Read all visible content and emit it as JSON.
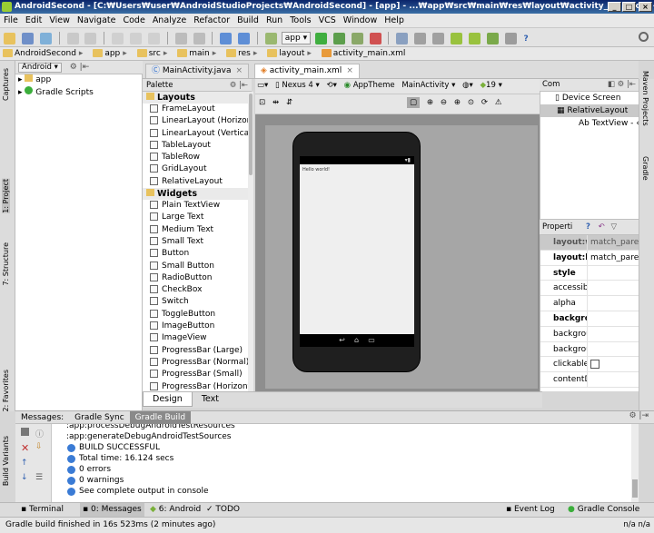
{
  "window": {
    "title": "AndroidSecond - [C:₩Users₩user₩AndroidStudioProjects₩AndroidSecond] - [app] - ...₩app₩src₩main₩res₩layout₩activity_main.xml - "
  },
  "menu": [
    "File",
    "Edit",
    "View",
    "Navigate",
    "Code",
    "Analyze",
    "Refactor",
    "Build",
    "Run",
    "Tools",
    "VCS",
    "Window",
    "Help"
  ],
  "toolbar": {
    "run_config": "app",
    "help": "?"
  },
  "breadcrumbs": [
    "AndroidSecond",
    "app",
    "src",
    "main",
    "res",
    "layout",
    "activity_main.xml"
  ],
  "project": {
    "view_selector": "Android",
    "tree": [
      "app",
      "Gradle Scripts"
    ]
  },
  "left_tabs": [
    "1: Project",
    "7: Structure",
    "Captures",
    "2: Favorites",
    "Build Variants"
  ],
  "right_tabs": [
    "Maven Projects",
    "Gradle"
  ],
  "editor": {
    "tabs": [
      "MainActivity.java",
      "activity_main.xml"
    ]
  },
  "palette": {
    "header": "Palette",
    "layouts_title": "Layouts",
    "layouts": [
      "FrameLayout",
      "LinearLayout (Horizonta",
      "LinearLayout (Vertical)",
      "TableLayout",
      "TableRow",
      "GridLayout",
      "RelativeLayout"
    ],
    "widgets_title": "Widgets",
    "widgets": [
      "Plain TextView",
      "Large Text",
      "Medium Text",
      "Small Text",
      "Button",
      "Small Button",
      "RadioButton",
      "CheckBox",
      "Switch",
      "ToggleButton",
      "ImageButton",
      "ImageView",
      "ProgressBar (Large)",
      "ProgressBar (Normal)",
      "ProgressBar (Small)",
      "ProgressBar (Horizonta"
    ]
  },
  "design_toolbar": {
    "device": "Nexus 4",
    "theme": "AppTheme",
    "activity": "MainActivity",
    "api": "19"
  },
  "preview": {
    "text": "Hello world!"
  },
  "design_tabs": [
    "Design",
    "Text"
  ],
  "component_tree": {
    "header": "Com",
    "items": [
      "Device Screen",
      "RelativeLayout",
      "TextView - «"
    ]
  },
  "properties": {
    "header": "Properti",
    "rows": [
      {
        "key": "layout:w",
        "value": "match_paren"
      },
      {
        "key": "layout:h",
        "value": "match_paren"
      },
      {
        "key": "style",
        "value": ""
      },
      {
        "key": "accessib",
        "value": ""
      },
      {
        "key": "alpha",
        "value": ""
      },
      {
        "key": "backgro",
        "value": ""
      },
      {
        "key": "backgrou",
        "value": ""
      },
      {
        "key": "backgrou",
        "value": ""
      },
      {
        "key": "clickable",
        "value": ""
      },
      {
        "key": "contentDe",
        "value": ""
      }
    ]
  },
  "messages": {
    "label": "Messages:",
    "tabs": [
      "Gradle Sync",
      "Gradle Build"
    ],
    "lines": [
      ":app:processDebugAndroidTestResources",
      ":app:generateDebugAndroidTestSources",
      "BUILD SUCCESSFUL",
      "Total time: 16.124 secs",
      "0 errors",
      "0 warnings",
      "See complete output in console"
    ]
  },
  "bottom_tabs": [
    "Terminal",
    "0: Messages",
    "6: Android",
    "TODO",
    "Event Log",
    "Gradle Console"
  ],
  "status": {
    "text": "Gradle build finished in 16s 523ms (2 minutes ago)",
    "right": "n/a   n/a"
  }
}
